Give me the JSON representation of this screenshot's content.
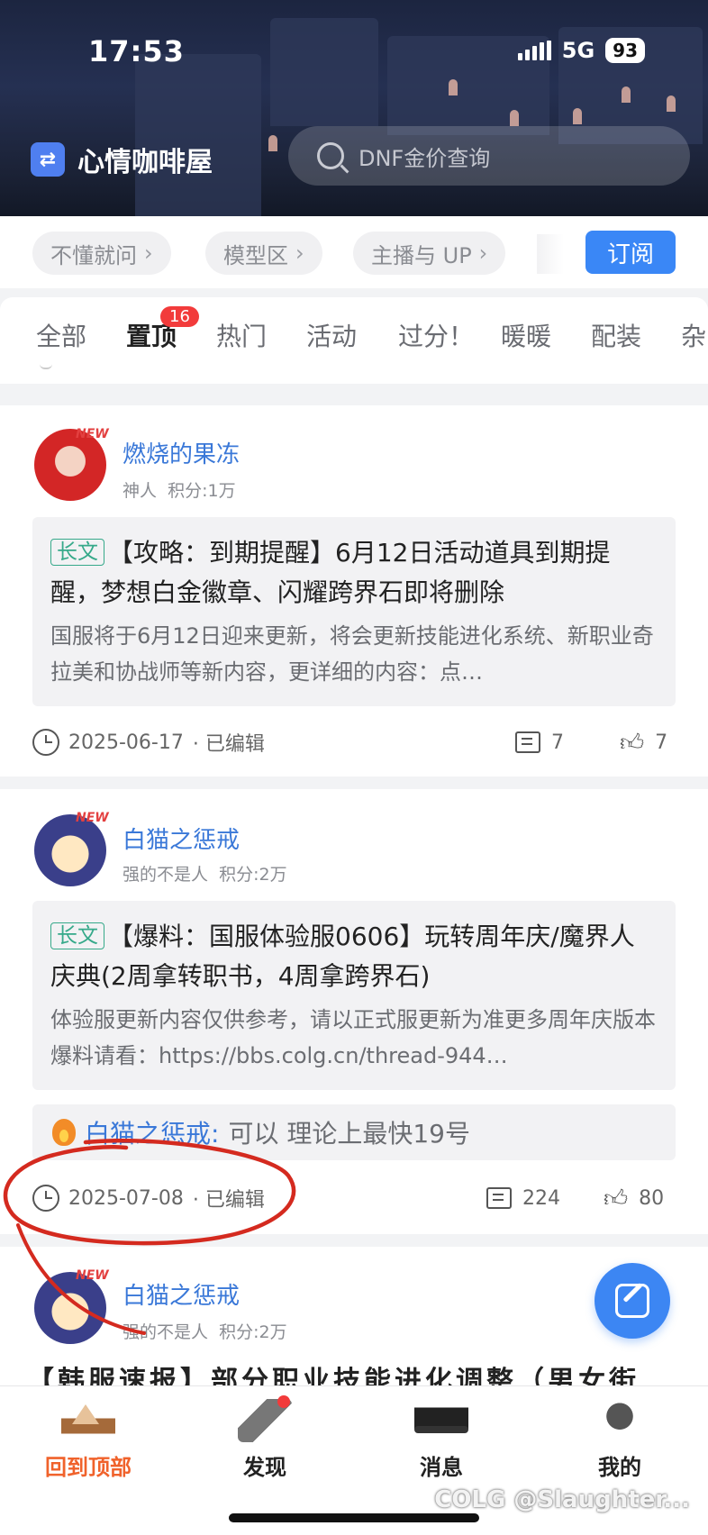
{
  "status_bar": {
    "time": "17:53",
    "network": "5G",
    "battery": "93"
  },
  "header": {
    "board_name": "心情咖啡屋",
    "search_placeholder": "DNF金价查询"
  },
  "tags": [
    {
      "label": "不懂就问"
    },
    {
      "label": "模型区"
    },
    {
      "label": "主播与 UP"
    }
  ],
  "subscribe_label": "订阅",
  "tabs": [
    {
      "label": "全部"
    },
    {
      "label": "置顶",
      "badge": "16"
    },
    {
      "label": "热门"
    },
    {
      "label": "活动"
    },
    {
      "label": "过分！"
    },
    {
      "label": "暖暖"
    },
    {
      "label": "配装"
    },
    {
      "label": "杂"
    }
  ],
  "posts": [
    {
      "author": "燃烧的果冻",
      "new_badge": "NEW",
      "rank": "神人",
      "score": "积分:1万",
      "label": "长文",
      "title": "【攻略：到期提醒】6月12日活动道具到期提醒，梦想白金徽章、闪耀跨界石即将删除",
      "summary": "国服将于6月12日迎来更新，将会更新技能进化系统、新职业奇拉美和协战师等新内容，更详细的内容：点…",
      "date": "2025-06-17",
      "edited": "· 已编辑",
      "comments": "7",
      "likes": "7"
    },
    {
      "author": "白猫之惩戒",
      "new_badge": "NEW",
      "rank": "强的不是人",
      "score": "积分:2万",
      "label": "长文",
      "title": "【爆料：国服体验服0606】玩转周年庆/魔界人庆典(2周拿转职书，4周拿跨界石)",
      "summary": "体验服更新内容仅供参考，请以正式服更新为准更多周年庆版本爆料请看：https://bbs.colg.cn/thread-944…",
      "hot_reply_author": "白猫之惩戒:",
      "hot_reply_text": "可以 理论上最快19号",
      "date": "2025-07-08",
      "edited": "· 已编辑",
      "comments": "224",
      "likes": "80"
    },
    {
      "author": "白猫之惩戒",
      "new_badge": "NEW",
      "rank": "强的不是人",
      "score": "积分:2万",
      "title": "【韩服速报】部分职业技能进化调整（男女街"
    }
  ],
  "bottom_nav": [
    {
      "label": "回到顶部"
    },
    {
      "label": "发现"
    },
    {
      "label": "消息"
    },
    {
      "label": "我的"
    }
  ],
  "watermark": "COLG @Slaughter...",
  "colors": {
    "accent": "#3a87f6",
    "author_link": "#3a78d8",
    "active_nav": "#f0622b",
    "long_label": "#36a98a",
    "badge": "#f23b3b",
    "annotation": "#d42a1f"
  }
}
